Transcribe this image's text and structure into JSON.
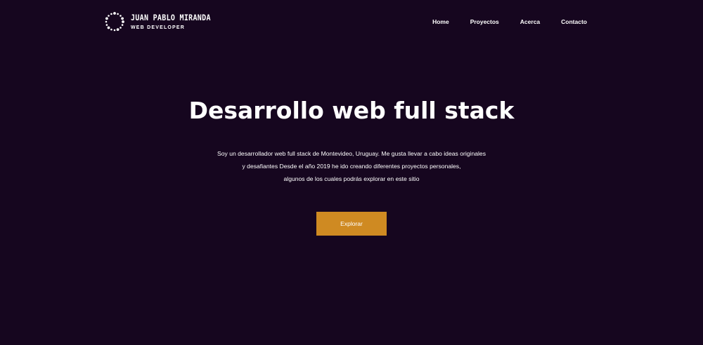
{
  "header": {
    "logo": {
      "name": "JUAN PABLO MIRANDA",
      "role": "WEB DEVELOPER",
      "icon": "dotted-circle-logo-icon"
    },
    "nav": [
      {
        "label": "Home"
      },
      {
        "label": "Proyectos"
      },
      {
        "label": "Acerca"
      },
      {
        "label": "Contacto"
      }
    ]
  },
  "hero": {
    "title": "Desarrollo web full stack",
    "description_lines": [
      "Soy un desarrollador web full stack de Montevideo, Uruguay. Me gusta llevar a cabo ideas originales",
      "y desafiantes Desde el año 2019 he ido creando diferentes proyectos personales,",
      "algunos de los cuales podrás explorar en este sitio"
    ],
    "cta_label": "Explorar"
  },
  "colors": {
    "background": "#16061f",
    "accent": "#cf8a22",
    "text": "#ffffff"
  }
}
